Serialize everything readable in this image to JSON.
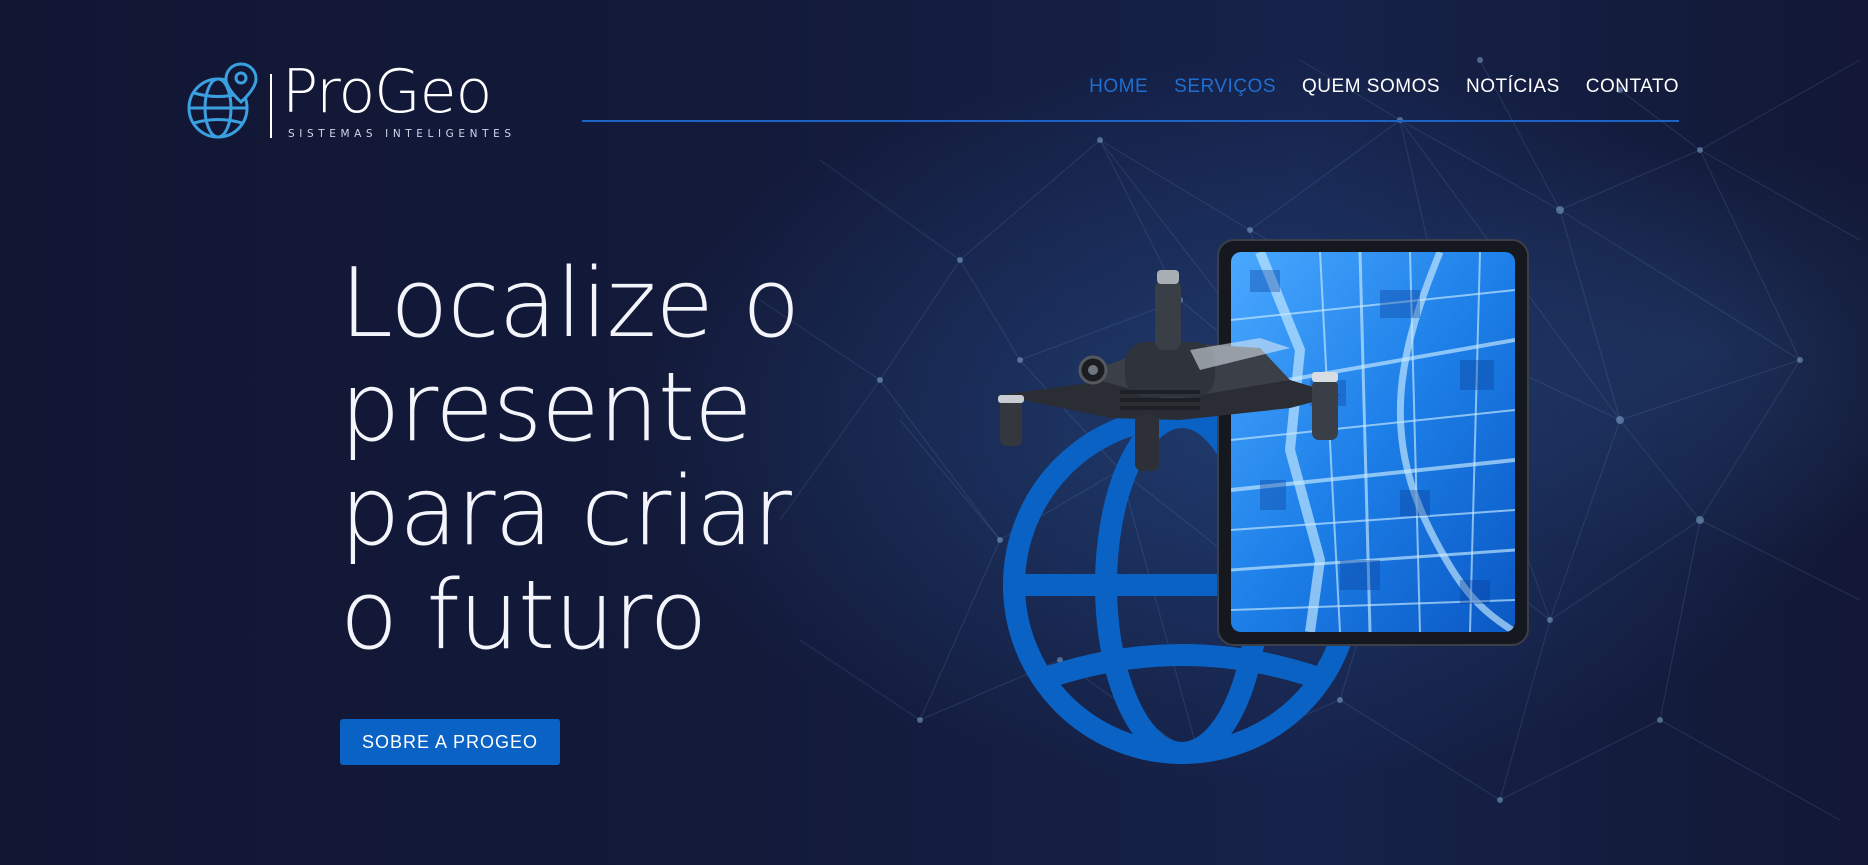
{
  "brand": {
    "name": "ProGeo",
    "tagline": "SISTEMAS INTELIGENTES",
    "logo_icon": "globe-pin-icon",
    "accent_color": "#1d63c5"
  },
  "nav": {
    "items": [
      {
        "label": "HOME",
        "active": true
      },
      {
        "label": "SERVIÇOS",
        "active": true
      },
      {
        "label": "QUEM SOMOS",
        "active": false
      },
      {
        "label": "NOTÍCIAS",
        "active": false
      },
      {
        "label": "CONTATO",
        "active": false
      }
    ]
  },
  "hero": {
    "headline_lines": [
      "Localize o",
      "presente",
      "para criar",
      "o futuro"
    ],
    "cta_label": "SOBRE A PROGEO",
    "illustration": [
      "drone",
      "tablet-city-map",
      "globe-icon"
    ]
  },
  "colors": {
    "background": "#121735",
    "button": "#0a63c4",
    "nav_active": "#1f6fd1"
  }
}
